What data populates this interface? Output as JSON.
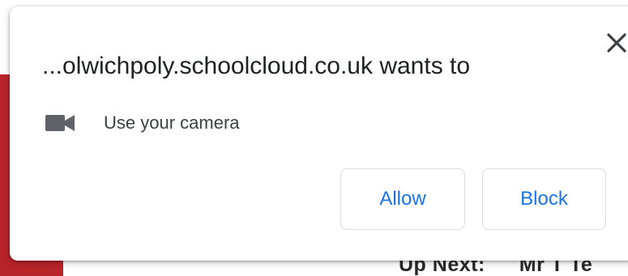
{
  "background": {
    "up_next_label": "Up Next:",
    "up_next_value": "Mr T Te",
    "sidebar_color": "#b8242a"
  },
  "dialog": {
    "title": "...olwichpoly.schoolcloud.co.uk wants to",
    "permission": {
      "icon": "camera-icon",
      "label": "Use your camera"
    },
    "buttons": {
      "allow_label": "Allow",
      "block_label": "Block"
    },
    "close_icon": "close-icon",
    "accent_color": "#1a73e8"
  }
}
